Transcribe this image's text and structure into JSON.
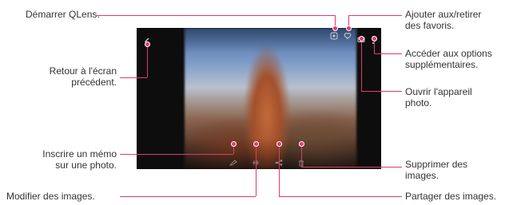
{
  "callouts": {
    "start_qlens": "Démarrer QLens.",
    "back_previous": [
      "Retour à l'écran",
      "précédent."
    ],
    "write_memo": [
      "Inscrire un mémo",
      "sur une photo."
    ],
    "edit_images": "Modifier des images.",
    "add_remove_favorites": [
      "Ajouter aux/retirer",
      "des favoris."
    ],
    "more_options": [
      "Accéder aux options",
      "supplémentaires."
    ],
    "open_camera": [
      "Ouvrir l'appareil",
      "photo."
    ],
    "delete_images": [
      "Supprimer des",
      "images."
    ],
    "share_images": "Partager des images."
  },
  "icons": {
    "qlens": "qlens-icon",
    "favorite": "heart-icon",
    "camera": "camera-icon",
    "more": "more-options-icon",
    "back": "back-arrow-icon",
    "memo": "pen-icon",
    "edit": "edit-icon",
    "share": "share-icon",
    "delete": "trash-icon"
  },
  "colors": {
    "callout_line": "#e23a6a",
    "text": "#333333"
  }
}
